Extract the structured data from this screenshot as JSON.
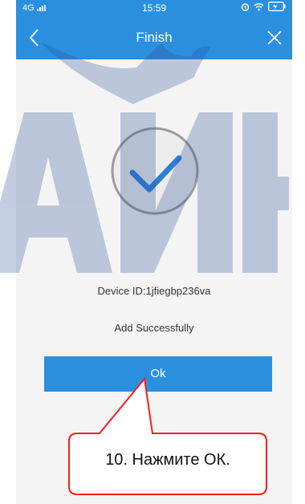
{
  "status_bar": {
    "network": "4G",
    "time": "15:59"
  },
  "nav": {
    "title": "Finish",
    "back_icon": "chevron-left-icon",
    "close_icon": "close-icon"
  },
  "content": {
    "device_id": "Device ID:1jfiegbp236va",
    "status_text": "Add Successfully",
    "ok_label": "Ok",
    "success_icon": "checkmark-circle-icon"
  },
  "annotation": {
    "text": "10. Нажмите ОК."
  },
  "watermark_text": "АИН",
  "colors": {
    "accent": "#2b8fe0",
    "callout_border": "#ff1a1a",
    "check": "#2b7fd6"
  }
}
